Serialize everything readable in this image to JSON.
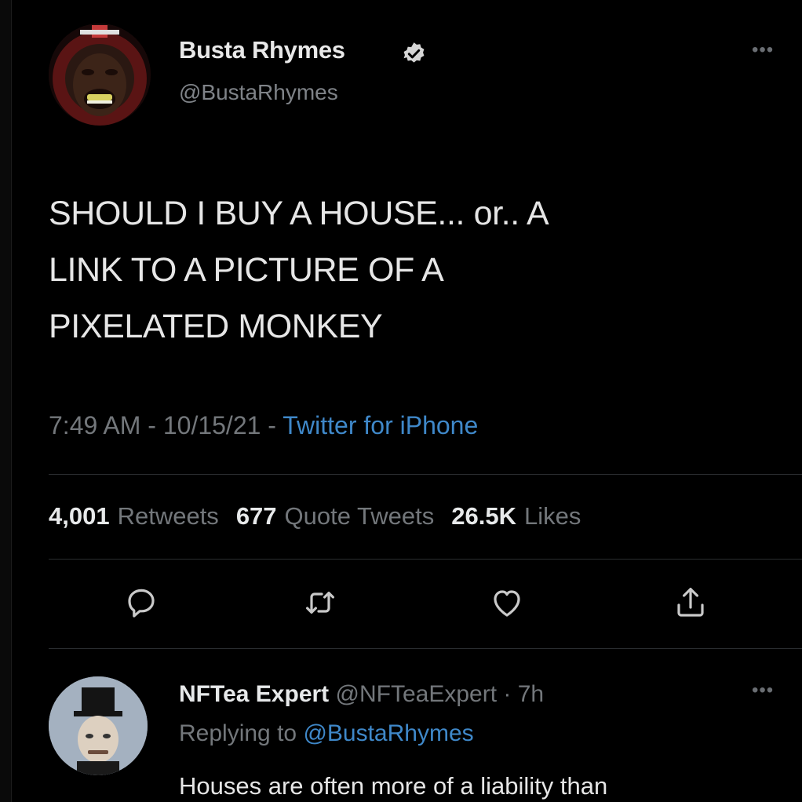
{
  "tweet": {
    "author": {
      "name": "Busta Rhymes",
      "handle": "@BustaRhymes",
      "verified": true,
      "more_icon": "ellipsis-icon"
    },
    "text_lines": [
      "SHOULD I BUY A HOUSE... or.. A",
      "LINK TO A PICTURE OF A",
      "PIXELATED MONKEY"
    ],
    "time": "7:49 AM",
    "date": "10/15/21",
    "separator": " - ",
    "source": "Twitter for iPhone",
    "stats": {
      "retweets": {
        "count": "4,001",
        "label": "Retweets"
      },
      "quote_tweets": {
        "count": "677",
        "label": "Quote Tweets"
      },
      "likes": {
        "count": "26.5K",
        "label": "Likes"
      }
    },
    "actions": [
      "reply-icon",
      "retweet-icon",
      "like-icon",
      "share-icon"
    ]
  },
  "reply": {
    "author": {
      "name": "NFTea Expert",
      "handle": "@NFTeaExpert",
      "age": "7h",
      "separator": " · "
    },
    "replying_to_label": "Replying to",
    "replying_to_handle": "@BustaRhymes",
    "text": "Houses are often more of a liability than"
  },
  "colors": {
    "background": "#000000",
    "primary_text": "#e7e9ea",
    "secondary_text": "#73777b",
    "link": "#3f88c9",
    "divider": "#2a2d30"
  }
}
